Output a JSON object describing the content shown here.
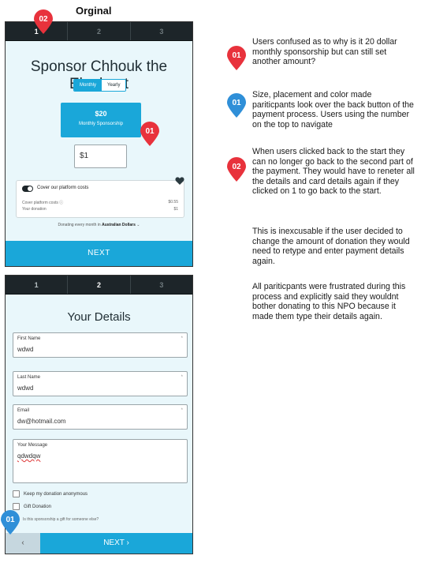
{
  "page": {
    "title": "Orginal"
  },
  "screen1": {
    "steps": [
      "1",
      "2",
      "3"
    ],
    "title": "Sponsor Chhouk the Elephant",
    "toggle": {
      "monthly": "Monthly",
      "yearly": "Yearly"
    },
    "amount_card": {
      "value": "$20",
      "label": "Monthly Sponsorship"
    },
    "custom_amount": "$1",
    "cover": {
      "label": "Cover our platform costs",
      "row1_label": "Cover platform costs ⓘ",
      "row1_value": "$0.55",
      "row2_label": "Your donation",
      "row2_value": "$1"
    },
    "currency_prefix": "Donating every month in ",
    "currency_bold": "Australian Dollars",
    "currency_suffix": " ⌄",
    "next_label": "NEXT"
  },
  "screen2": {
    "steps": [
      "1",
      "2",
      "3"
    ],
    "title": "Your Details",
    "fields": [
      {
        "label": "First Name",
        "required": "*",
        "value": "wdwd"
      },
      {
        "label": "Last Name",
        "required": "*",
        "value": "wdwd"
      },
      {
        "label": "Email",
        "required": "*",
        "value": "dw@hotmail.com"
      },
      {
        "label": "Your Message",
        "required": "",
        "value": "qdwdqw"
      }
    ],
    "checkboxes": [
      "Keep my donation anonymous",
      "Gift Donation"
    ],
    "gift_note": "Is this sponsorship a gift for someone else?",
    "back_label": "‹",
    "next_label": "NEXT  ›"
  },
  "markers": {
    "top": "02",
    "amount": "01",
    "back": "01",
    "r1": "01",
    "r2": "01",
    "r3": "02"
  },
  "colors": {
    "marker_red": "#e8323c",
    "marker_blue": "#2f8fd8",
    "accent": "#1aa7d9"
  },
  "notes": [
    "Users confused as to why is it 20 dollar monthly sponsorship but can still set another amount?",
    "Size, placement and color made pariticpants look over the back button of the payment process. Users using the number on the top to navigate",
    "When users clicked back to the start they can no longer go back to the second part of the payment. They would have to reneter all the details and card details again if they clicked on 1 to go back to the start.",
    "This is inexcusable if the user decided to change the amount of donation they would need to retype and enter payment details again.",
    "All pariticpants were frustrated during this process and explicitly said they wouldnt bother donating to this NPO because it made them type their details again."
  ]
}
